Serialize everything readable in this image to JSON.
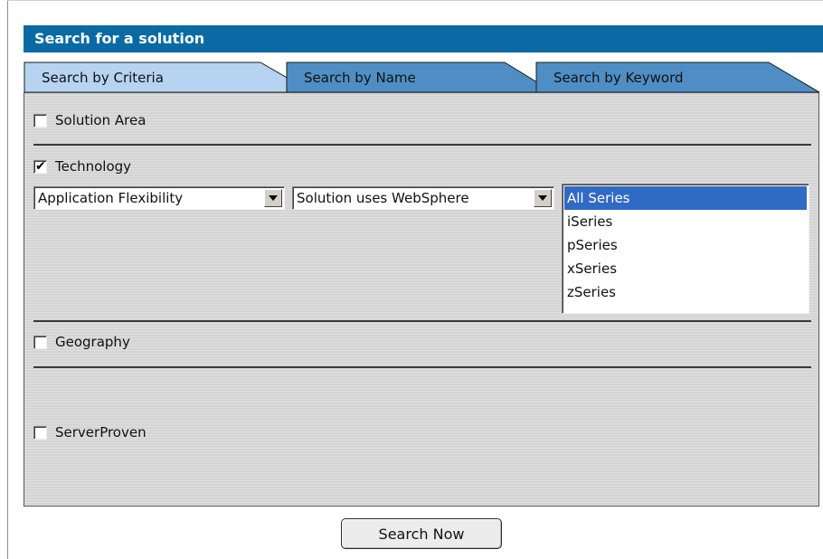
{
  "title": "Search for a solution",
  "tabs": [
    {
      "label": "Search by Criteria",
      "active": true
    },
    {
      "label": "Search by Name",
      "active": false
    },
    {
      "label": "Search by Keyword",
      "active": false
    }
  ],
  "criteria": {
    "solution_area": {
      "label": "Solution Area",
      "checked": false
    },
    "technology": {
      "label": "Technology",
      "checked": true,
      "checkmark": "✔",
      "dropdown1_value": "Application Flexibility",
      "dropdown2_value": "Solution uses WebSphere",
      "series_options": [
        "All Series",
        "iSeries",
        "pSeries",
        "xSeries",
        "zSeries"
      ],
      "series_selected": "All Series"
    },
    "geography": {
      "label": "Geography",
      "checked": false
    },
    "serverproven": {
      "label": "ServerProven",
      "checked": false
    }
  },
  "search_button_label": "Search Now",
  "colors": {
    "title_bar": "#0a6aa3",
    "active_tab": "#b6d4f1",
    "inactive_tab": "#4f8ec4",
    "selection": "#316ac5",
    "panel": "#d4d4d4"
  }
}
